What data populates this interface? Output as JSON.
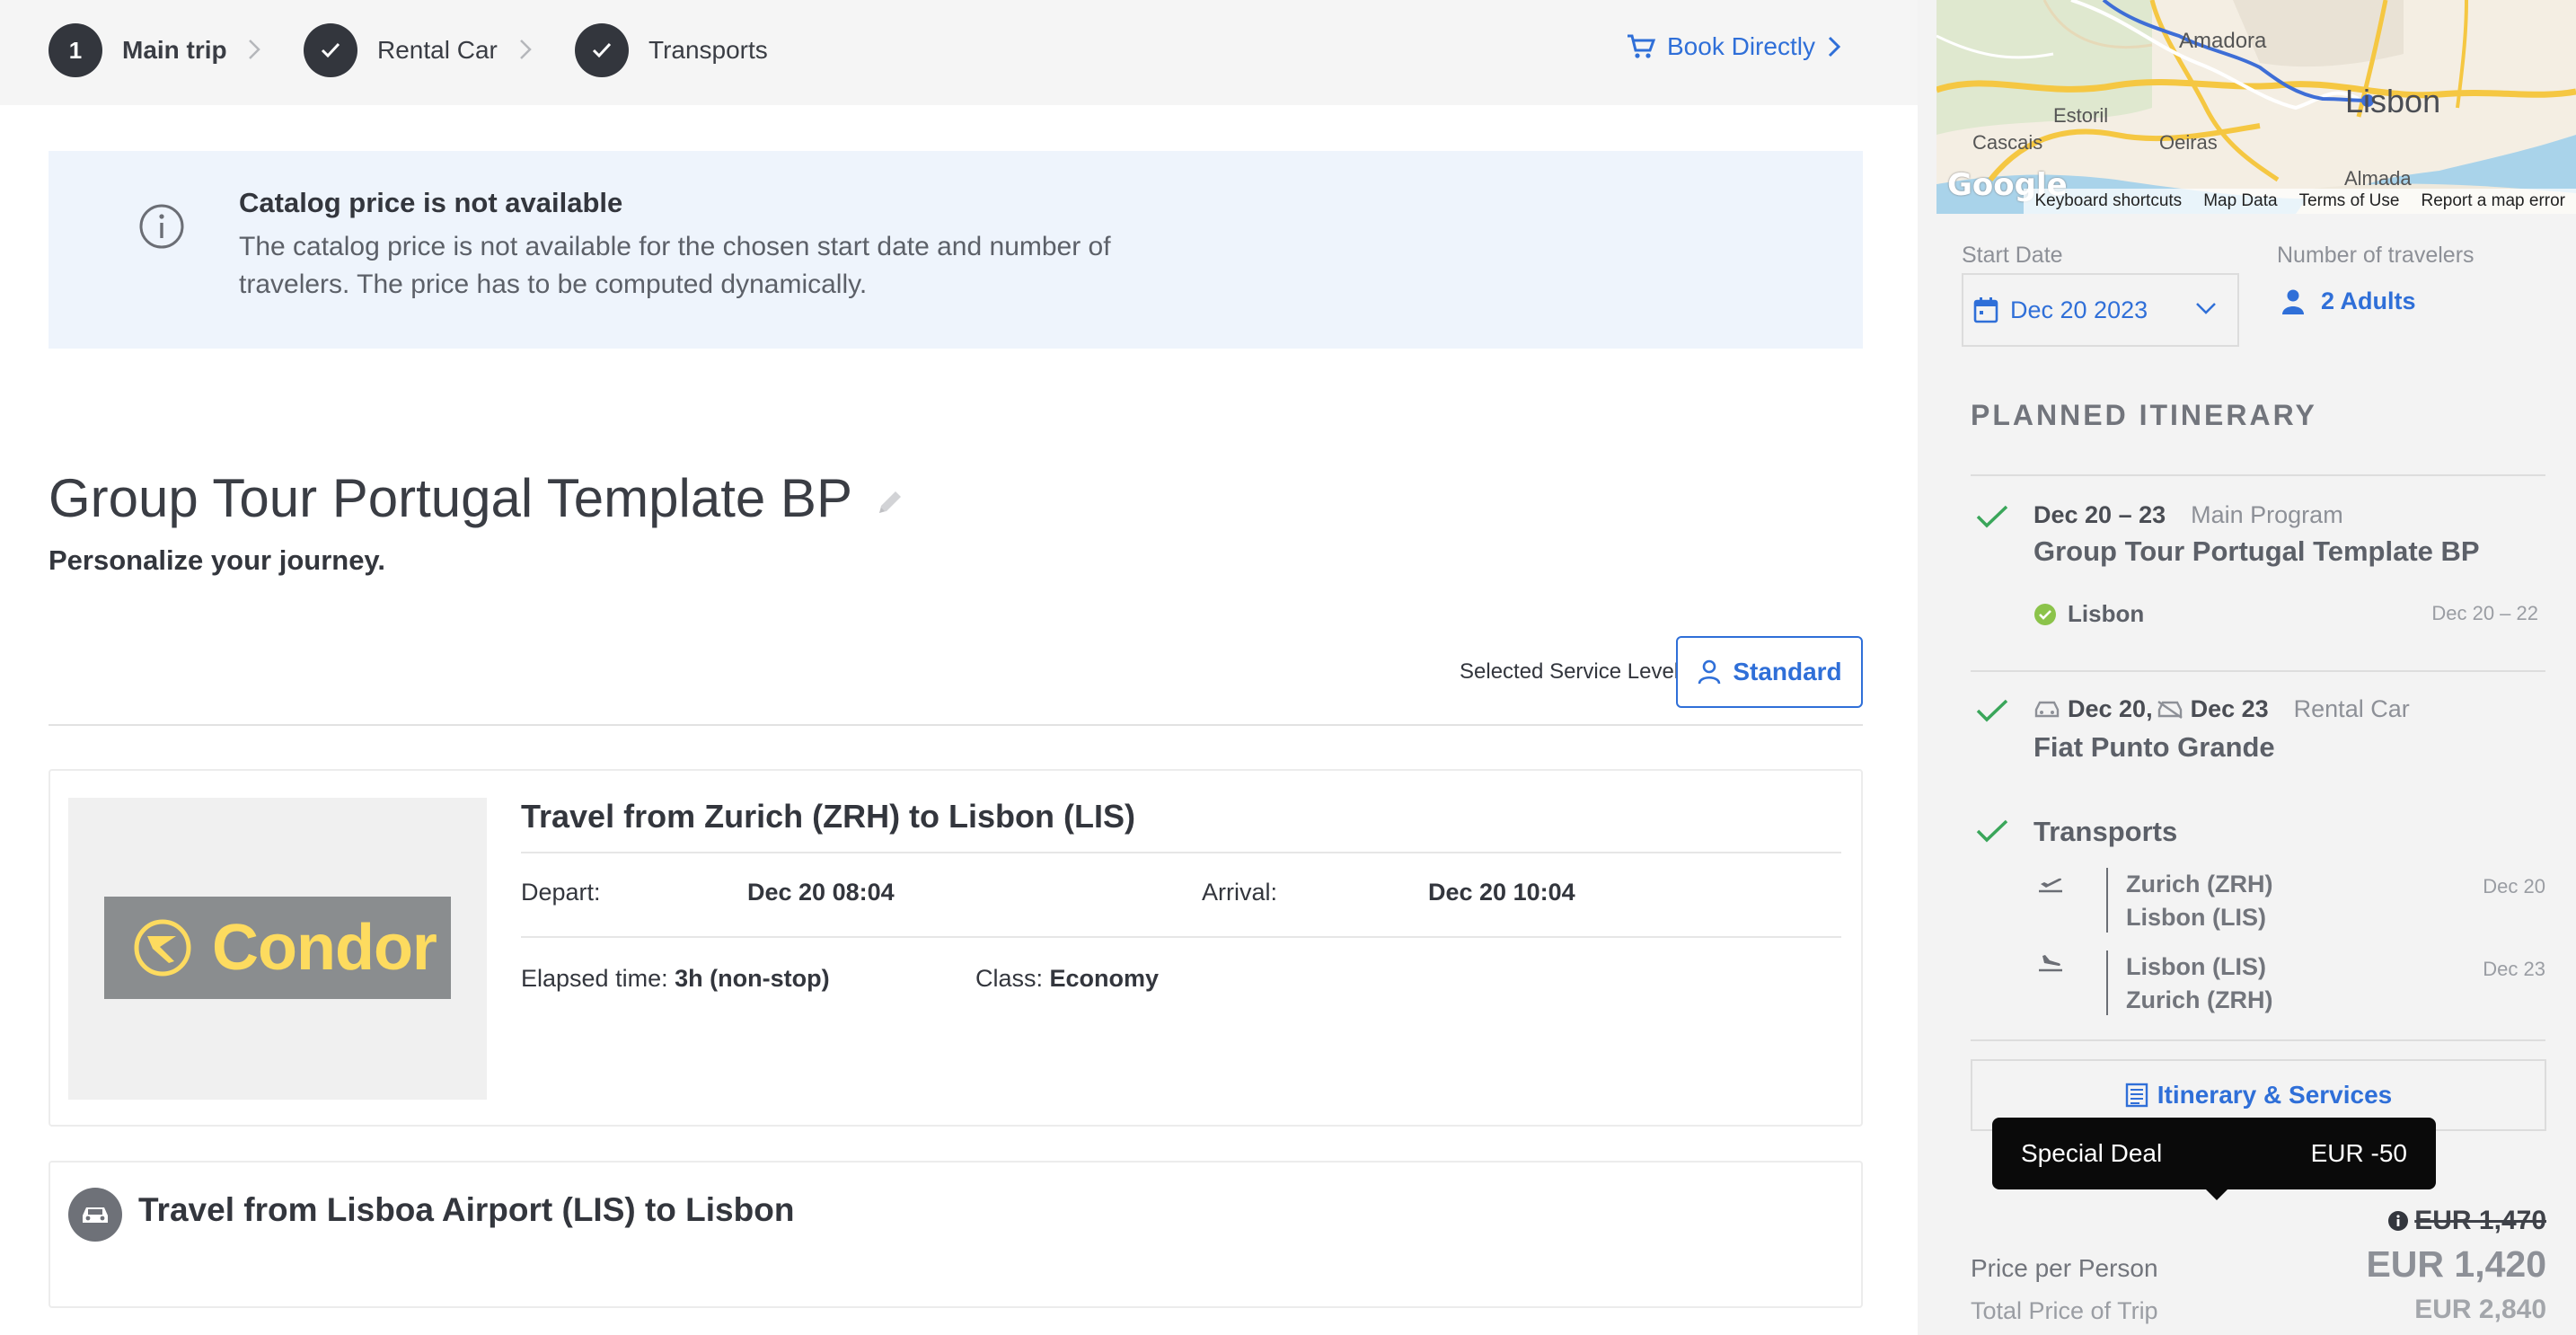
{
  "stepper": {
    "steps": [
      {
        "badge": "1",
        "label": "Main trip"
      },
      {
        "label": "Rental Car"
      },
      {
        "label": "Transports"
      }
    ],
    "book_directly": "Book Directly"
  },
  "banner": {
    "title": "Catalog price is not available",
    "text": "The catalog price is not available for the chosen start date and number of travelers. The price has to be computed dynamically."
  },
  "trip": {
    "title": "Group Tour Portugal Template BP",
    "subtitle": "Personalize your journey."
  },
  "service_level": {
    "label": "Selected Service Level",
    "value": "Standard"
  },
  "flight_card": {
    "title": "Travel from Zurich (ZRH) to Lisbon (LIS)",
    "airline": "Condor",
    "depart_label": "Depart:",
    "depart_value": "Dec 20 08:04",
    "arrival_label": "Arrival:",
    "arrival_value": "Dec 20 10:04",
    "elapsed_label": "Elapsed time:",
    "elapsed_value": "3h (non-stop)",
    "class_label": "Class:",
    "class_value": "Economy"
  },
  "transfer_card": {
    "title": "Travel from Lisboa Airport (LIS) to Lisbon"
  },
  "map": {
    "labels": [
      "Amadora",
      "Lisbon",
      "Estoril",
      "Cascais",
      "Oeiras",
      "Almada"
    ],
    "brand": "Google",
    "footer": [
      "Keyboard shortcuts",
      "Map Data",
      "Terms of Use",
      "Report a map error"
    ]
  },
  "sidebar": {
    "start_date_label": "Start Date",
    "start_date_value": "Dec 20 2023",
    "travelers_label": "Number of travelers",
    "travelers_value": "2 Adults",
    "planned_title": "PLANNED ITINERARY",
    "main_program": {
      "dates": "Dec 20 – 23",
      "type": "Main Program",
      "name": "Group Tour Portugal Template BP",
      "city": "Lisbon",
      "city_dates": "Dec 20 – 22"
    },
    "rental_car": {
      "pickup": "Dec 20,",
      "dropoff": "Dec 23",
      "type": "Rental Car",
      "name": "Fiat Punto Grande"
    },
    "transports": {
      "title": "Transports",
      "legs": [
        {
          "from": "Zurich (ZRH)",
          "to": "Lisbon (LIS)",
          "date": "Dec 20"
        },
        {
          "from": "Lisbon (LIS)",
          "to": "Zurich (ZRH)",
          "date": "Dec 23"
        }
      ]
    },
    "itinerary_button": "Itinerary & Services",
    "deal": {
      "label": "Special Deal",
      "value": "EUR -50"
    },
    "old_price": "EUR 1,470",
    "price_per_person_label": "Price per Person",
    "price_per_person_value": "EUR 1,420",
    "total_label": "Total Price of Trip",
    "total_value": "EUR 2,840"
  },
  "colors": {
    "accent": "#2f6fd8",
    "check_green": "#3aa65a",
    "dark": "#33363d",
    "banner_bg": "#eef4fc",
    "condor_yellow": "#fddb5f"
  }
}
